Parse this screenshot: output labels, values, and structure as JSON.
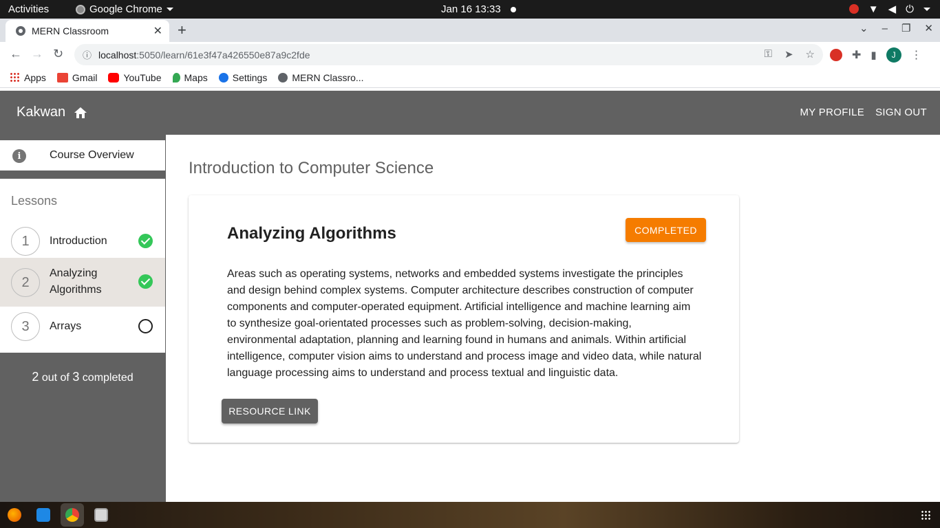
{
  "system_bar": {
    "activities": "Activities",
    "app_name": "Google Chrome",
    "clock": "Jan 16  13:33"
  },
  "browser": {
    "tab_title": "MERN Classroom",
    "url_host": "localhost",
    "url_path": ":5050/learn/61e3f47a426550e87a9c2fde",
    "profile_initial": "J",
    "bookmarks": [
      "Apps",
      "Gmail",
      "YouTube",
      "Maps",
      "Settings",
      "MERN Classro..."
    ]
  },
  "header": {
    "brand": "Kakwan",
    "nav": [
      "MY PROFILE",
      "SIGN OUT"
    ]
  },
  "sidebar": {
    "overview_label": "Course Overview",
    "lessons_heading": "Lessons",
    "lessons": [
      {
        "number": "1",
        "title": "Introduction",
        "completed": true
      },
      {
        "number": "2",
        "title": "Analyzing Algorithms",
        "completed": true
      },
      {
        "number": "3",
        "title": "Arrays",
        "completed": false
      }
    ],
    "progress": {
      "done": "2",
      "total": "3",
      "out_of": "out of",
      "suffix": "completed"
    }
  },
  "main": {
    "course_title": "Introduction to Computer Science",
    "lesson_title": "Analyzing Algorithms",
    "status_label": "COMPLETED",
    "content": "Areas such as operating systems, networks and embedded systems investigate the principles and design behind complex systems. Computer architecture describes construction of computer components and computer-operated equipment. Artificial intelligence and machine learning aim to synthesize goal-orientated processes such as problem-solving, decision-making, environmental adaptation, planning and learning found in humans and animals. Within artificial intelligence, computer vision aims to understand and process image and video data, while natural language processing aims to understand and process textual and linguistic data.",
    "resource_label": "RESOURCE LINK"
  },
  "colors": {
    "appbar": "#616161",
    "status": "#f57c00",
    "check": "#34c759"
  }
}
